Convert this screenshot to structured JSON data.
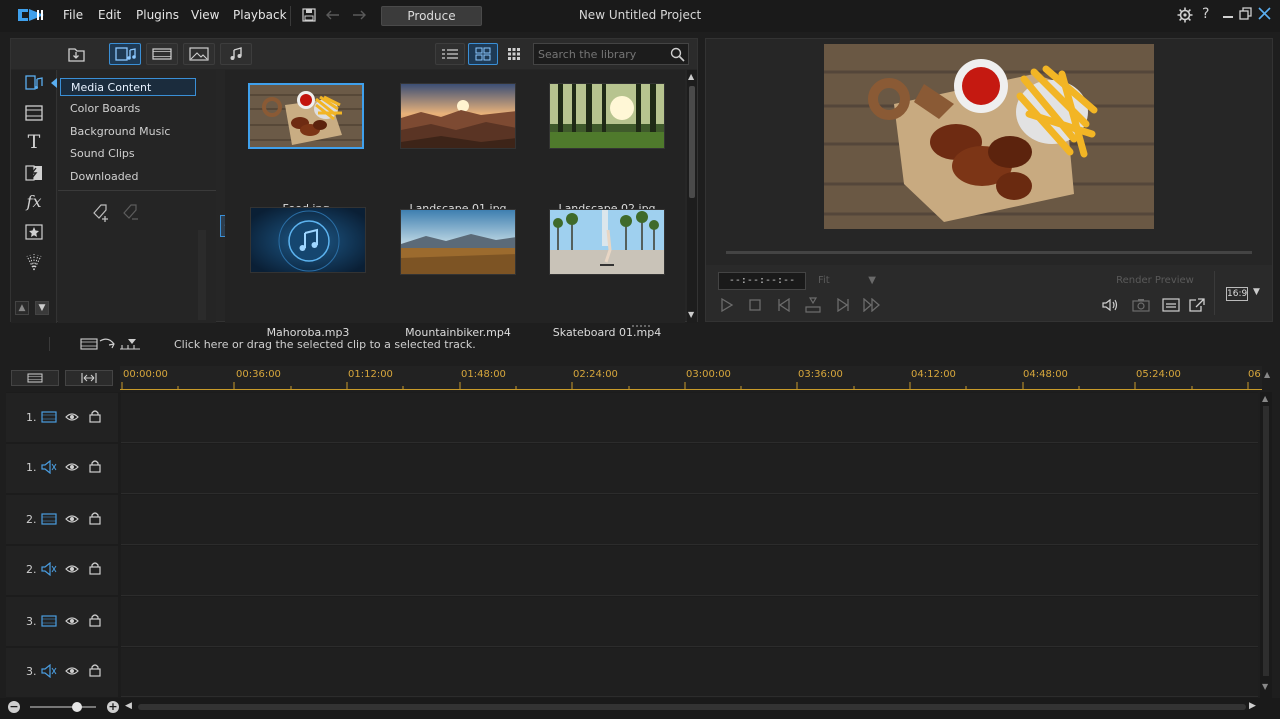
{
  "app": {
    "menu": [
      "File",
      "Edit",
      "Plugins",
      "View",
      "Playback"
    ],
    "produce_label": "Produce",
    "title": "New Untitled Project"
  },
  "library": {
    "search_placeholder": "Search the library",
    "categories": [
      "Media Content",
      "Color Boards",
      "Background Music",
      "Sound Clips",
      "Downloaded"
    ],
    "selected_category": "Media Content",
    "items": [
      {
        "label": "Food.jpg",
        "kind": "photo-food",
        "selected": true
      },
      {
        "label": "Landscape 01.jpg",
        "kind": "photo-canyon"
      },
      {
        "label": "Landscape 02.jpg",
        "kind": "photo-forest"
      },
      {
        "label": "Mahoroba.mp3",
        "kind": "audio"
      },
      {
        "label": "Mountainbiker.mp4",
        "kind": "video-mountain"
      },
      {
        "label": "Skateboard 01.mp4",
        "kind": "video-skate"
      }
    ]
  },
  "preview": {
    "timecode": "--:--:--:--",
    "fit_label": "Fit",
    "render_label": "Render Preview",
    "aspect": "16:9"
  },
  "timeline": {
    "hint": "Click here or drag the selected clip to a selected track.",
    "ruler_ticks": [
      "00:00:00",
      "00:36:00",
      "01:12:00",
      "01:48:00",
      "02:24:00",
      "03:00:00",
      "03:36:00",
      "04:12:00",
      "04:48:00",
      "05:24:00",
      "06"
    ],
    "tracks": [
      {
        "num": "1.",
        "type": "video"
      },
      {
        "num": "1.",
        "type": "audio"
      },
      {
        "num": "2.",
        "type": "video"
      },
      {
        "num": "2.",
        "type": "audio"
      },
      {
        "num": "3.",
        "type": "video"
      },
      {
        "num": "3.",
        "type": "audio"
      }
    ]
  },
  "colors": {
    "accent": "#3a8fd6",
    "ruler": "#d6a63c",
    "bg": "#1e1e1e"
  }
}
